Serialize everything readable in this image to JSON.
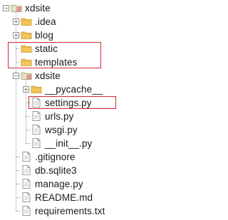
{
  "tree": {
    "nodes": [
      {
        "id": "xdsite-root",
        "label": "xdsite",
        "depth": 0,
        "kind": "project",
        "toggle": "−",
        "icon": "project-folder-icon"
      },
      {
        "id": "idea",
        "label": ".idea",
        "depth": 1,
        "kind": "folder",
        "toggle": "+",
        "icon": "folder-icon"
      },
      {
        "id": "blog",
        "label": "blog",
        "depth": 1,
        "kind": "folder",
        "toggle": "+",
        "icon": "folder-icon"
      },
      {
        "id": "static",
        "label": "static",
        "depth": 1,
        "kind": "folder",
        "toggle": "",
        "icon": "folder-icon"
      },
      {
        "id": "templates",
        "label": "templates",
        "depth": 1,
        "kind": "folder",
        "toggle": "",
        "icon": "folder-icon"
      },
      {
        "id": "xdsite-pkg",
        "label": "xdsite",
        "depth": 1,
        "kind": "package",
        "toggle": "−",
        "icon": "package-folder-icon"
      },
      {
        "id": "pycache",
        "label": "__pycache__",
        "depth": 2,
        "kind": "folder",
        "toggle": "+",
        "icon": "folder-icon"
      },
      {
        "id": "settings",
        "label": "settings.py",
        "depth": 2,
        "kind": "file",
        "toggle": "",
        "icon": "file-icon"
      },
      {
        "id": "urls",
        "label": "urls.py",
        "depth": 2,
        "kind": "file",
        "toggle": "",
        "icon": "file-icon"
      },
      {
        "id": "wsgi",
        "label": "wsgi.py",
        "depth": 2,
        "kind": "file",
        "toggle": "",
        "icon": "file-icon"
      },
      {
        "id": "init",
        "label": "__init__.py",
        "depth": 2,
        "kind": "file",
        "toggle": "",
        "icon": "file-icon"
      },
      {
        "id": "gitignore",
        "label": ".gitignore",
        "depth": 1,
        "kind": "file",
        "toggle": "",
        "icon": "file-icon"
      },
      {
        "id": "dbsqlite",
        "label": "db.sqlite3",
        "depth": 1,
        "kind": "file",
        "toggle": "",
        "icon": "file-icon"
      },
      {
        "id": "manage",
        "label": "manage.py",
        "depth": 1,
        "kind": "file",
        "toggle": "",
        "icon": "file-icon"
      },
      {
        "id": "readme",
        "label": "README.md",
        "depth": 1,
        "kind": "file",
        "toggle": "",
        "icon": "file-icon"
      },
      {
        "id": "requirements",
        "label": "requirements.txt",
        "depth": 1,
        "kind": "file",
        "toggle": "",
        "icon": "file-icon"
      }
    ],
    "highlights": [
      {
        "name": "static-templates-highlight",
        "items": [
          "static",
          "templates"
        ]
      },
      {
        "name": "settings-highlight",
        "items": [
          "settings"
        ]
      }
    ]
  },
  "colors": {
    "highlight_border": "#cc2b36",
    "folder_fill": "#f3c55a",
    "folder_edge": "#c9962a",
    "package_fill": "#e8e0c8",
    "package_edge": "#c04848",
    "file_edge": "#7a7a7a"
  }
}
